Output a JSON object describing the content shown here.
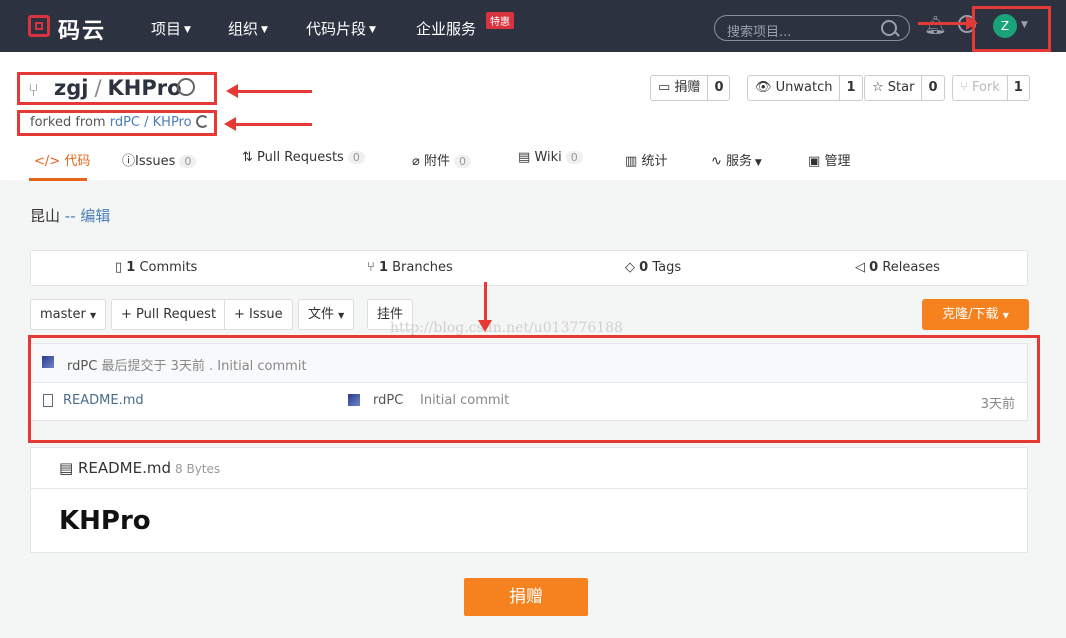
{
  "nav": {
    "logo_text": "码云",
    "items": [
      "项目",
      "组织",
      "代码片段",
      "企业服务"
    ],
    "hot_badge": "特惠",
    "search_placeholder": "搜索项目...",
    "avatar_letter": "Z"
  },
  "repo": {
    "owner": "zgj",
    "separator": "/",
    "name": "KHPro",
    "forked_prefix": "forked from",
    "forked_source": "rdPC / KHPro"
  },
  "actions": [
    {
      "label": "捐赠",
      "count": "0"
    },
    {
      "label": "Unwatch",
      "count": "1"
    },
    {
      "label": "Star",
      "count": "0"
    },
    {
      "label": "Fork",
      "count": "1"
    }
  ],
  "tabs": [
    {
      "label": "代码",
      "count": ""
    },
    {
      "label": "Issues",
      "count": "0"
    },
    {
      "label": "Pull Requests",
      "count": "0"
    },
    {
      "label": "附件",
      "count": "0"
    },
    {
      "label": "Wiki",
      "count": "0"
    },
    {
      "label": "统计",
      "count": ""
    },
    {
      "label": "服务",
      "count": ""
    },
    {
      "label": "管理",
      "count": ""
    }
  ],
  "description": {
    "text": "昆山",
    "edit": "-- 编辑"
  },
  "stats": {
    "commits": {
      "count": "1",
      "label": "Commits"
    },
    "branches": {
      "count": "1",
      "label": "Branches"
    },
    "tags": {
      "count": "0",
      "label": "Tags"
    },
    "releases": {
      "count": "0",
      "label": "Releases"
    }
  },
  "toolbar": {
    "branch": "master",
    "pull_request": "+ Pull Request",
    "issue": "+ Issue",
    "files": "文件",
    "widgets": "挂件",
    "clone": "克隆/下载"
  },
  "watermark": "http://blog.csdn.net/u013776188",
  "last_commit": {
    "user": "rdPC",
    "text": "最后提交于",
    "time": "3天前",
    "dot": ".",
    "message": "Initial commit"
  },
  "files": [
    {
      "name": "README.md",
      "user": "rdPC",
      "message": "Initial commit",
      "time": "3天前"
    }
  ],
  "readme": {
    "title": "README.md",
    "size": "8 Bytes",
    "heading": "KHPro"
  },
  "donate": "捐赠",
  "colors": {
    "accent": "#f5811f",
    "nav_bg": "#2c323f",
    "annotation": "#e53935"
  }
}
